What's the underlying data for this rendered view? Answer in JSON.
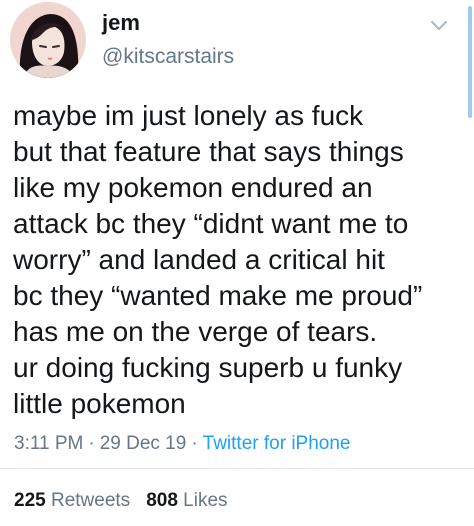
{
  "user": {
    "display_name": "jem",
    "handle": "@kitscarstairs"
  },
  "tweet": {
    "text": "maybe im just lonely as fuck\nbut that feature that says things\nlike my pokemon endured an\nattack bc they “didnt want me to\nworry” and landed a critical hit\nbc they “wanted make me proud”\nhas me on the verge of tears.\nur doing fucking superb u funky\nlittle pokemon",
    "time": "3:11 PM",
    "date": "29 Dec 19",
    "source": "Twitter for iPhone",
    "separator": "·"
  },
  "stats": {
    "retweets_count": "225",
    "retweets_label": "Retweets",
    "likes_count": "808",
    "likes_label": "Likes"
  },
  "colors": {
    "text": "#14171a",
    "secondary": "#657786",
    "accent": "#1da1f2",
    "divider": "#e1e8ed"
  },
  "icons": {
    "menu": "chevron-down-icon",
    "avatar": "avatar"
  }
}
